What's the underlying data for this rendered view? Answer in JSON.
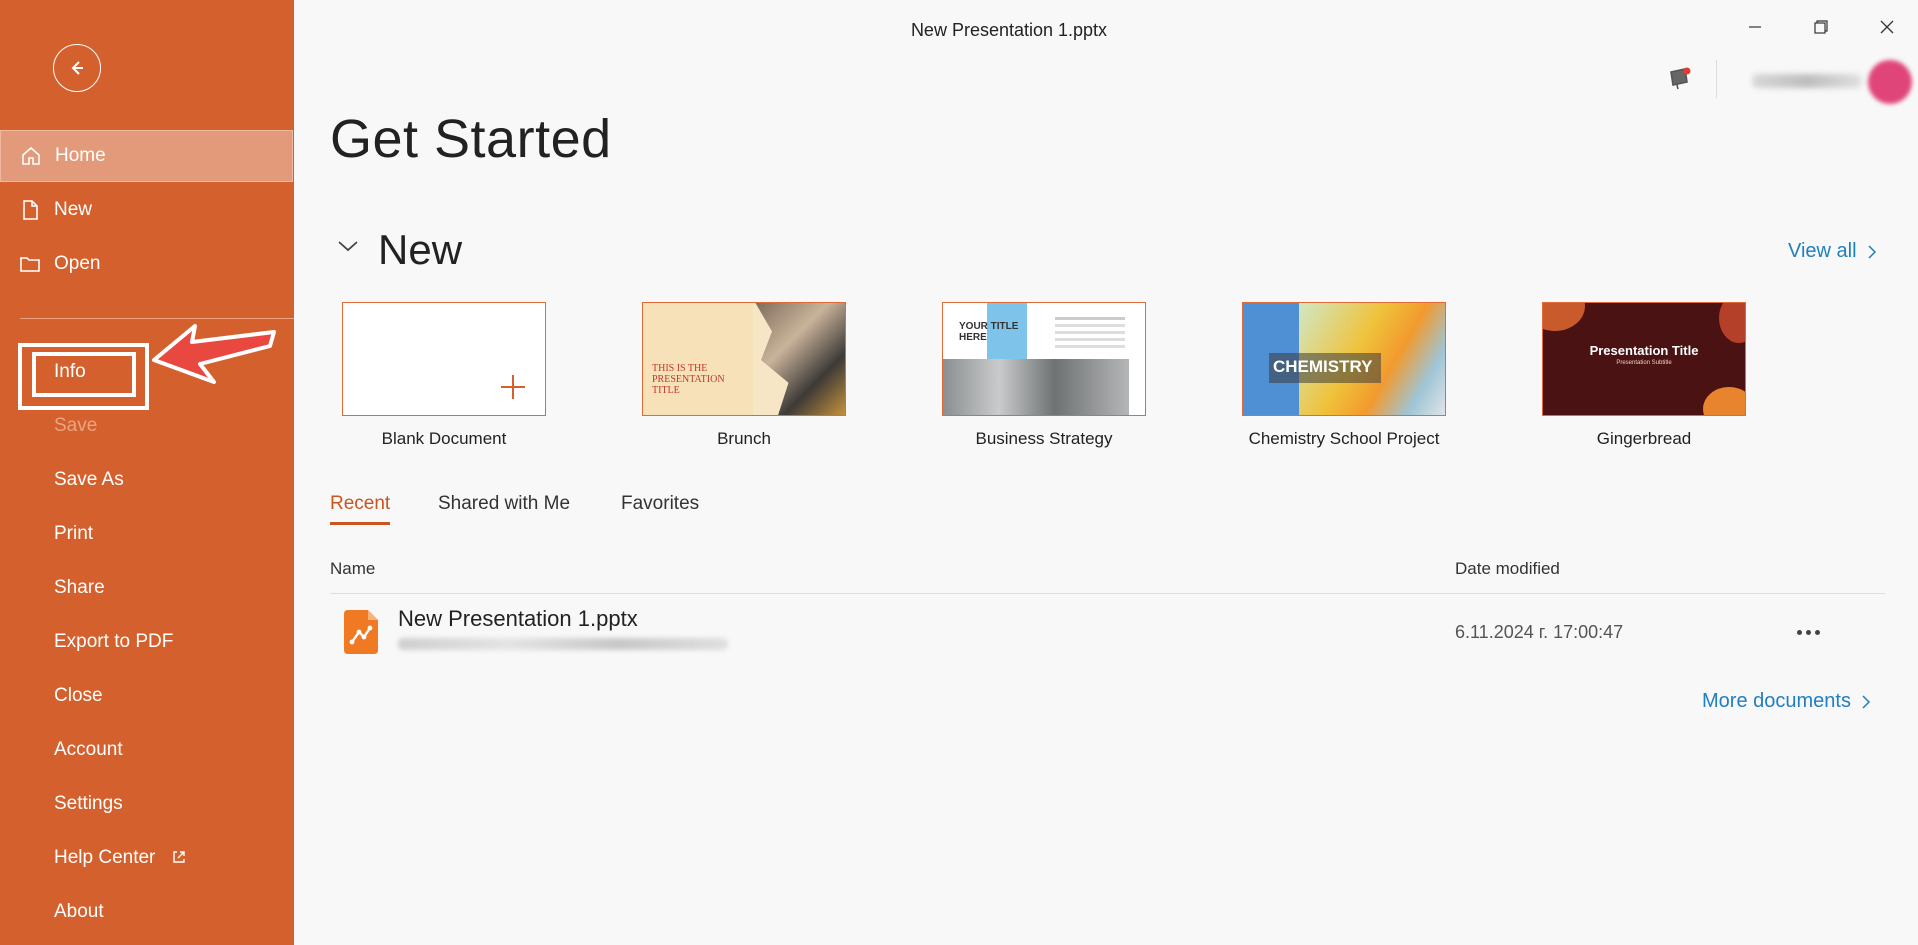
{
  "window": {
    "title": "New Presentation 1.pptx"
  },
  "sidebar": {
    "items": [
      {
        "label": "Home",
        "icon": "home-icon"
      },
      {
        "label": "New",
        "icon": "new-file-icon"
      },
      {
        "label": "Open",
        "icon": "folder-icon"
      },
      {
        "label": "Info"
      },
      {
        "label": "Save"
      },
      {
        "label": "Save As"
      },
      {
        "label": "Print"
      },
      {
        "label": "Share"
      },
      {
        "label": "Export to PDF"
      },
      {
        "label": "Close"
      },
      {
        "label": "Account"
      },
      {
        "label": "Settings"
      },
      {
        "label": "Help Center",
        "icon": "external-link-icon"
      },
      {
        "label": "About"
      }
    ],
    "active": "Home",
    "disabled": [
      "Save"
    ],
    "highlighted": "Info"
  },
  "main": {
    "title": "Get Started",
    "new_section": {
      "title": "New",
      "view_all": "View all",
      "templates": [
        {
          "name": "Blank Document"
        },
        {
          "name": "Brunch",
          "thumb_title": "THIS IS THE PRESENTATION TITLE"
        },
        {
          "name": "Business Strategy",
          "thumb_title": "YOUR TITLE HERE"
        },
        {
          "name": "Chemistry School Project",
          "thumb_title": "CHEMISTRY"
        },
        {
          "name": "Gingerbread",
          "thumb_title": "Presentation Title",
          "thumb_subtitle": "Presentation Subtitle"
        }
      ]
    },
    "tabs": [
      {
        "label": "Recent",
        "active": true
      },
      {
        "label": "Shared with Me"
      },
      {
        "label": "Favorites"
      }
    ],
    "table": {
      "columns": [
        "Name",
        "Date modified"
      ],
      "rows": [
        {
          "name": "New Presentation 1.pptx",
          "date": "6.11.2024 г. 17:00:47"
        }
      ]
    },
    "more_documents": "More documents"
  },
  "colors": {
    "sidebar": "#d4612d",
    "accent": "#c9551f",
    "link": "#1f7fc2"
  }
}
